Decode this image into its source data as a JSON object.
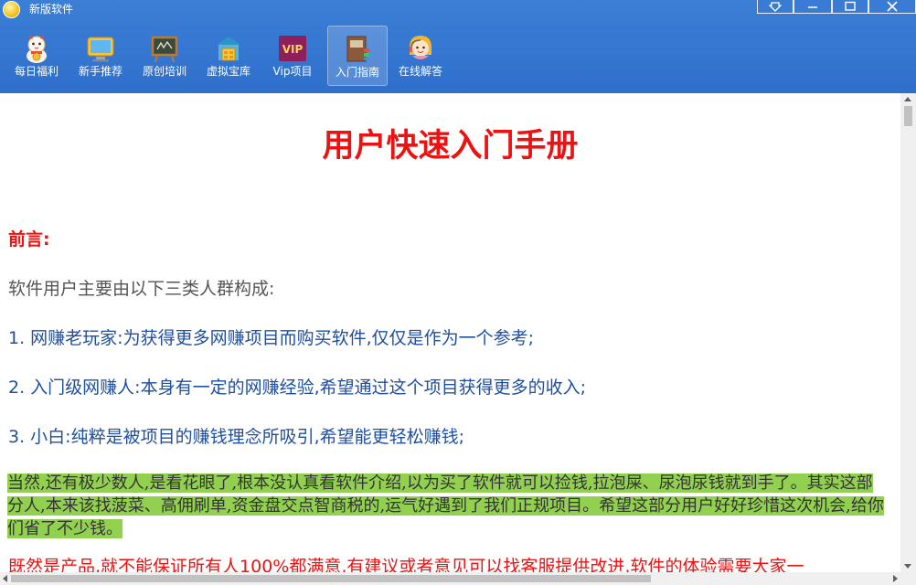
{
  "window": {
    "title": "新版软件",
    "controls": [
      "pin-icon",
      "minimize-icon",
      "maximize-icon",
      "close-icon"
    ]
  },
  "toolbar": {
    "items": [
      {
        "label": "每日福利",
        "icon": "lucky-cat-icon"
      },
      {
        "label": "新手推荐",
        "icon": "monitor-icon"
      },
      {
        "label": "原创培训",
        "icon": "blackboard-icon"
      },
      {
        "label": "虚拟宝库",
        "icon": "treasure-house-icon"
      },
      {
        "label": "Vip项目",
        "icon": "vip-icon"
      },
      {
        "label": "入门指南",
        "icon": "guide-book-icon",
        "active": true
      },
      {
        "label": "在线解答",
        "icon": "support-agent-icon"
      }
    ],
    "vip_badge": "VIP"
  },
  "document": {
    "title": "用户快速入门手册",
    "preface_heading": "前言:",
    "intro": "软件用户主要由以下三类人群构成:",
    "list": [
      "1. 网赚老玩家:为获得更多网赚项目而购买软件,仅仅是作为一个参考;",
      "2. 入门级网赚人:本身有一定的网赚经验,希望通过这个项目获得更多的收入;",
      "3. 小白:纯粹是被项目的赚钱理念所吸引,希望能更轻松赚钱;"
    ],
    "highlight_paragraph": "当然,还有极少数人,是看花眼了,根本没认真看软件介绍,以为买了软件就可以捡钱,拉泡屎、尿泡尿钱就到手了。其实这部分人,本来该找菠菜、高佣刷单,资金盘交点智商税的,运气好遇到了我们正规项目。希望这部分用户好好珍惜这次机会,给你们省了不少钱。",
    "red_paragraph": "既然是产品,就不能保证所有人100%都满意,有建议或者意见可以找客服提供改进,软件的体验需要大家一"
  },
  "colors": {
    "header_blue": "#3b7fd6",
    "title_red": "#ee1111",
    "list_blue": "#1f4fa0",
    "highlight_green": "#92d050"
  }
}
